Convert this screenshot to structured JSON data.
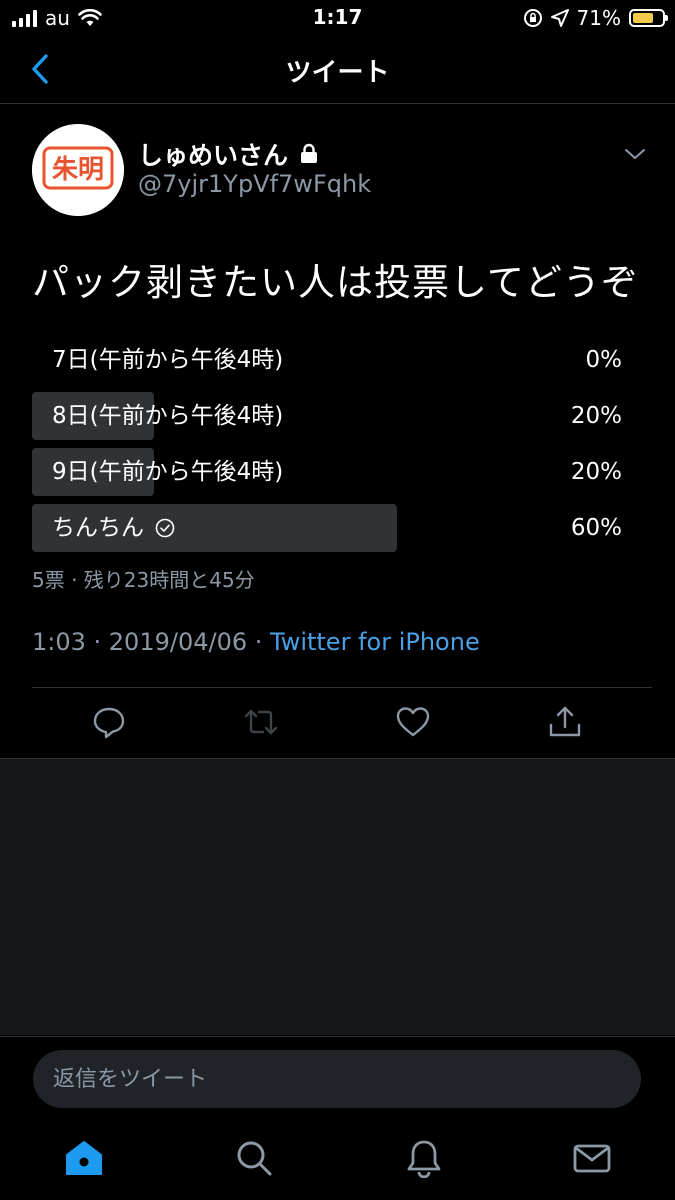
{
  "status_bar": {
    "carrier": "au",
    "time": "1:17",
    "battery_percent_text": "71%",
    "battery_level": 0.71,
    "battery_color": "#f2c94c"
  },
  "nav": {
    "title": "ツイート"
  },
  "tweet": {
    "display_name": "しゅめいさん",
    "handle": "@7yjr1YpVf7wFqhk",
    "avatar_text": "朱明",
    "text": "パック剥きたい人は投票してどうぞ",
    "poll": {
      "options": [
        {
          "label": "7日(午前から午後4時)",
          "percent": "0%",
          "fraction": 0.0,
          "selected": false
        },
        {
          "label": "8日(午前から午後4時)",
          "percent": "20%",
          "fraction": 0.2,
          "selected": false
        },
        {
          "label": "9日(午前から午後4時)",
          "percent": "20%",
          "fraction": 0.2,
          "selected": false
        },
        {
          "label": "ちんちん",
          "percent": "60%",
          "fraction": 0.6,
          "selected": true
        }
      ],
      "meta": "5票 · 残り23時間と45分"
    },
    "timestamp": "1:03 · 2019/04/06 · ",
    "source": "Twitter for iPhone"
  },
  "reply": {
    "placeholder": "返信をツイート"
  },
  "colors": {
    "accent": "#4aa0e6",
    "avatar_red": "#e8542f",
    "secondary_text": "#8b98a5"
  },
  "tabs": [
    "home-icon",
    "search-icon",
    "notifications-icon",
    "messages-icon"
  ]
}
